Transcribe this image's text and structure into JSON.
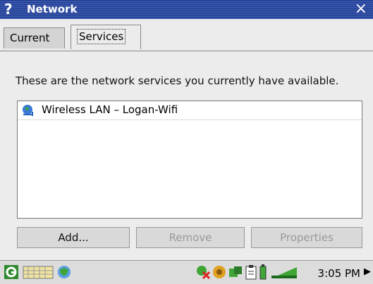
{
  "window": {
    "title": "Network",
    "help_glyph": "?",
    "close_glyph": "×"
  },
  "tabs": [
    {
      "label": "Current",
      "selected": false
    },
    {
      "label": "Services",
      "selected": true
    }
  ],
  "description": "These are the network services you currently have available.",
  "services": [
    {
      "name": "Wireless LAN – Logan-Wifi",
      "icon": "network-globe-icon"
    }
  ],
  "buttons": {
    "add": {
      "label": "Add...",
      "enabled": true
    },
    "remove": {
      "label": "Remove",
      "enabled": false
    },
    "properties": {
      "label": "Properties",
      "enabled": false
    }
  },
  "taskbar": {
    "clock": "3:05 PM",
    "left_icons": [
      "start-icon",
      "keyboard-icon",
      "network-monitor-icon"
    ],
    "tray_icons": [
      "network-status-icon",
      "sound-icon",
      "connection-icon",
      "clipboard-icon",
      "battery-icon",
      "signal-icon"
    ],
    "arrow_glyph": "▶"
  }
}
